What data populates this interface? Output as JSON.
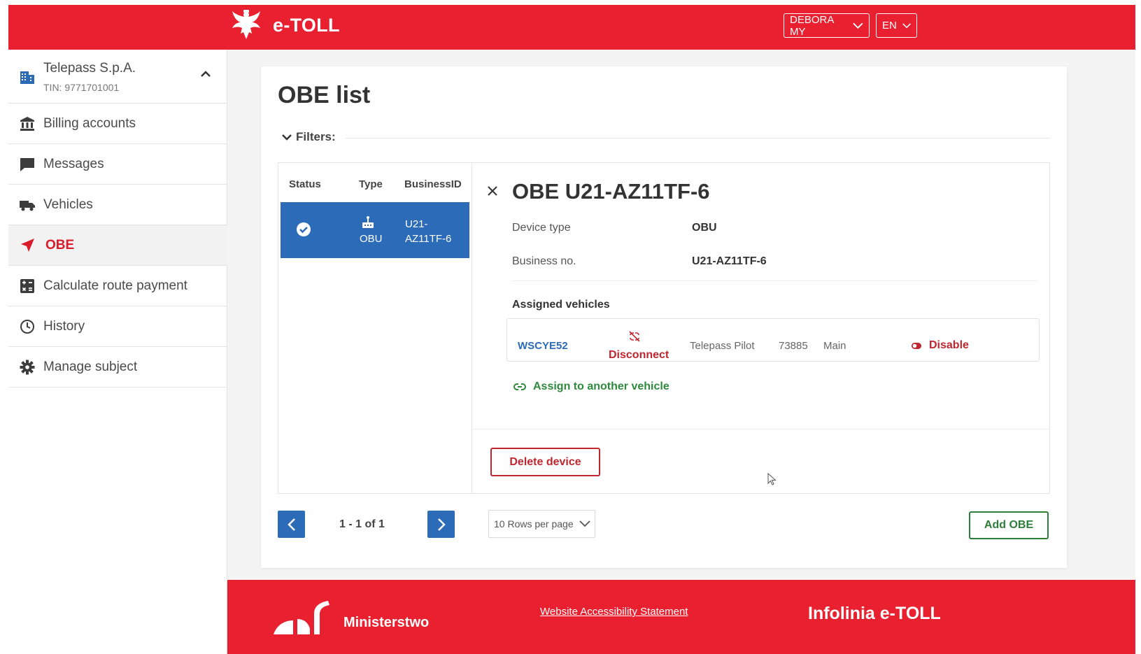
{
  "header": {
    "app_name": "e-TOLL",
    "user_label": "DEBORA MY",
    "lang_label": "EN"
  },
  "sidebar": {
    "company": {
      "name": "Telepass S.p.A.",
      "tin": "TIN: 9771701001"
    },
    "items": [
      {
        "label": "Billing accounts",
        "icon": "bank-icon"
      },
      {
        "label": "Messages",
        "icon": "message-icon"
      },
      {
        "label": "Vehicles",
        "icon": "truck-icon"
      },
      {
        "label": "OBE",
        "icon": "navigation-arrow-icon",
        "active": true
      },
      {
        "label": "Calculate route payment",
        "icon": "calculator-icon"
      },
      {
        "label": "History",
        "icon": "clock-icon"
      },
      {
        "label": "Manage subject",
        "icon": "gear-icon"
      }
    ]
  },
  "main": {
    "title": "OBE list",
    "filters_label": "Filters:",
    "table": {
      "columns": [
        "Status",
        "Type",
        "BusinessID"
      ],
      "rows": [
        {
          "status": "active",
          "type": "OBU",
          "business_id": "U21-AZ11TF-6"
        }
      ]
    },
    "detail": {
      "title": "OBE U21-AZ11TF-6",
      "device_type_label": "Device type",
      "device_type_value": "OBU",
      "business_no_label": "Business no.",
      "business_no_value": "U21-AZ11TF-6",
      "assigned_heading": "Assigned vehicles",
      "vehicle": {
        "plate": "WSCYE52",
        "disconnect_label": "Disconnect",
        "owner": "Telepass Pilot",
        "number": "73885",
        "role": "Main",
        "disable_label": "Disable"
      },
      "assign_label": "Assign to another vehicle",
      "delete_label": "Delete device"
    },
    "pagination": {
      "info": "1 - 1 of 1",
      "rows_per_page": "10 Rows per page"
    },
    "add_label": "Add OBE"
  },
  "footer": {
    "ministry_label": "Ministerstwo",
    "accessibility_label": "Website Accessibility Statement",
    "infolinia_label": "Infolinia e-TOLL"
  },
  "colors": {
    "brand_red": "#e8202f",
    "primary_blue": "#2b6bb8",
    "success_green": "#2e7d3a",
    "danger_red": "#c0262f"
  }
}
